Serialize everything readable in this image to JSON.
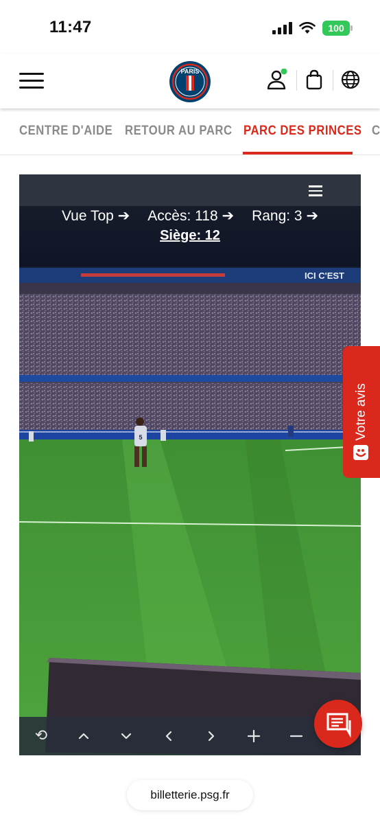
{
  "status_bar": {
    "time": "11:47",
    "battery": "100",
    "icons": [
      "signal-icon",
      "wifi-icon",
      "battery-icon"
    ]
  },
  "header": {
    "logo_text": "PARIS",
    "icons": [
      "menu-icon",
      "account-icon",
      "bag-icon",
      "globe-icon"
    ]
  },
  "nav": {
    "tabs": [
      {
        "label": "CENTRE D'AIDE"
      },
      {
        "label": "RETOUR AU PARC"
      },
      {
        "label": "PARC DES PRINCES",
        "active": true
      },
      {
        "label": "C"
      }
    ]
  },
  "viewer": {
    "breadcrumb": {
      "view": "Vue Top ➔",
      "access": "Accès: 118 ➔",
      "row": "Rang: 3 ➔",
      "seat": "Siège: 12"
    },
    "stadium_banner": "ICI C'EST",
    "player_number": "5",
    "controls": [
      "rotate-icon",
      "up-icon",
      "down-icon",
      "left-icon",
      "right-icon",
      "zoom-in-icon",
      "zoom-out-icon"
    ]
  },
  "feedback": {
    "label": "Votre avis"
  },
  "url": "billetterie.psg.fr",
  "colors": {
    "accent": "#da291c",
    "psg_navy": "#004170",
    "battery_green": "#34c759",
    "viewer_bar": "#2e3440"
  }
}
